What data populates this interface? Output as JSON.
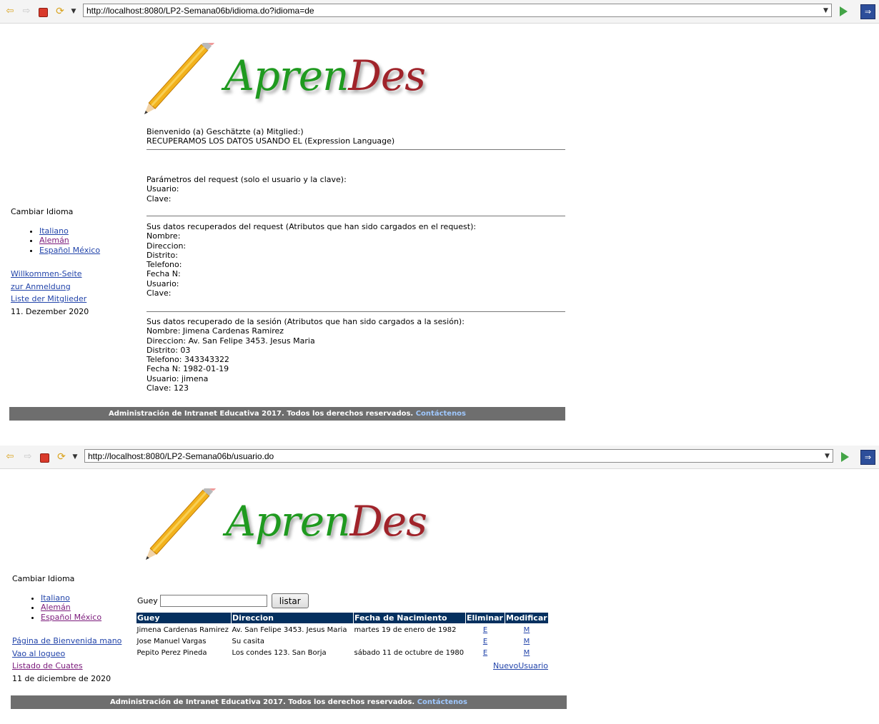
{
  "browser1": {
    "url": "http://localhost:8080/LP2-Semana06b/idioma.do?idioma=de"
  },
  "browser2": {
    "url": "http://localhost:8080/LP2-Semana06b/usuario.do"
  },
  "logo": {
    "part1": "Apren",
    "part2": "Des"
  },
  "page1": {
    "greeting": "Bienvenido (a) Geschätzte (a) Mitglied:)",
    "subtitle": "RECUPERAMOS LOS DATOS USANDO EL (Expression Language)",
    "params": [
      "Parámetros del request (solo el usuario y la clave):",
      "Usuario:",
      "Clave:"
    ],
    "request": [
      "Sus datos recuperados del request (Atributos que han sido cargados en el request):",
      "Nombre:",
      "Direccion:",
      "Distrito:",
      "Telefono:",
      "Fecha N:",
      "Usuario:",
      "Clave:"
    ],
    "session": [
      "Sus datos recuperado de la sesión (Atributos que han sido cargados a la sesión):",
      "Nombre: Jimena Cardenas Ramirez",
      "Direccion: Av. San Felipe 3453. Jesus Maria",
      "Distrito: 03",
      "Telefono: 343343322",
      "Fecha N: 1982-01-19",
      "Usuario: jimena",
      "Clave: 123"
    ],
    "sidebar": {
      "title": "Cambiar Idioma",
      "languages": [
        "Italiano",
        "Alemán",
        "Español México"
      ],
      "links": [
        "Willkommen-Seite",
        "zur Anmeldung",
        "Liste der Mitglieder"
      ],
      "date": "11. Dezember 2020"
    }
  },
  "page2": {
    "sidebar": {
      "title": "Cambiar Idioma",
      "languages": [
        "Italiano",
        "Alemán",
        "Español México"
      ],
      "links": [
        "Página de Bienvenida mano",
        "Vao al logueo",
        "Listado de Cuates"
      ],
      "date": "11 de diciembre de 2020"
    },
    "search": {
      "label": "Guey",
      "value": "",
      "button": "listar"
    },
    "table": {
      "headers": [
        "Guey",
        "Direccion",
        "Fecha de Nacimiento",
        "Eliminar",
        "Modificar"
      ],
      "rows": [
        [
          "Jimena Cardenas Ramirez",
          "Av. San Felipe 3453. Jesus Maria",
          "martes 19 de enero de 1982",
          "E",
          "M"
        ],
        [
          "Jose Manuel Vargas",
          "Su casita",
          "",
          "E",
          "M"
        ],
        [
          "Pepito Perez Pineda",
          "Los condes 123. San Borja",
          "sábado 11 de octubre de 1980",
          "E",
          "M"
        ]
      ]
    },
    "new_user": "NuevoUsuario"
  },
  "footer": {
    "text": "Administración de Intranet Educativa 2017. Todos los derechos reservados.",
    "link": "Contáctenos"
  }
}
